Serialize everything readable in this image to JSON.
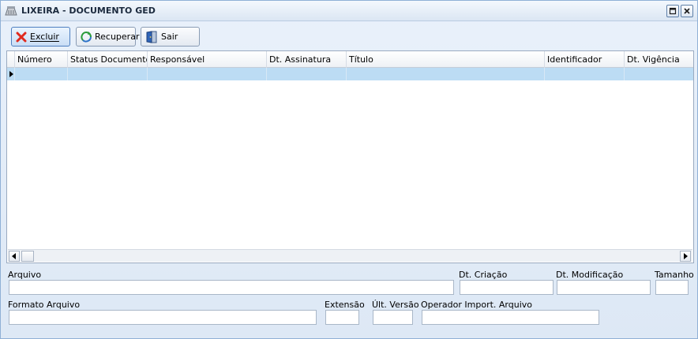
{
  "window": {
    "title": "LIXEIRA - DOCUMENTO GED"
  },
  "toolbar": {
    "buttons": [
      {
        "label": "Excluir",
        "icon": "red-x-icon"
      },
      {
        "label": "Recuperar",
        "icon": "recycle-icon"
      },
      {
        "label": "Sair",
        "icon": "exit-door-icon"
      }
    ]
  },
  "grid": {
    "columns": [
      "Número",
      "Status Documento G",
      "Responsável",
      "Dt. Assinatura",
      "Título",
      "Identificador",
      "Dt. Vigência"
    ],
    "rows": []
  },
  "form": {
    "arquivo_label": "Arquivo",
    "dt_criacao_label": "Dt. Criação",
    "dt_modificacao_label": "Dt. Modificação",
    "tamanho_label": "Tamanho",
    "formato_arquivo_label": "Formato Arquivo",
    "extensao_label": "Extensão",
    "ult_versao_label": "Últ. Versão",
    "operador_label": "Operador Import. Arquivo"
  },
  "colors": {
    "selected_row": "#bcdcf4",
    "accent": "#4d7fc0"
  }
}
